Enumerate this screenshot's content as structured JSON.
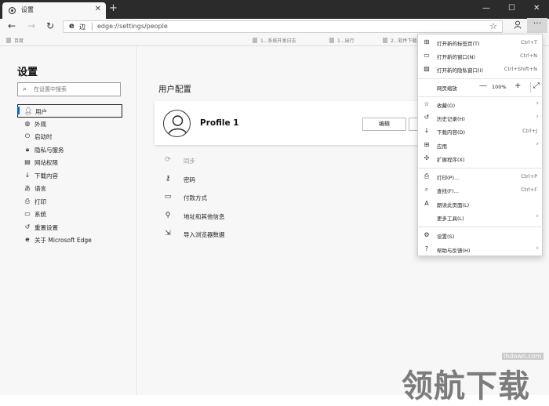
{
  "tab": {
    "title": "设置",
    "favicon": "gear-icon"
  },
  "toolbar": {
    "site_label": "边",
    "url": "edge://settings/people"
  },
  "favorites_bar": [
    {
      "label": "百度"
    },
    {
      "label": "1...系统开发日志"
    },
    {
      "label": "1...出行"
    },
    {
      "label": "2...软件下载"
    }
  ],
  "sidebar": {
    "title": "设置",
    "search_placeholder": "在设置中搜索",
    "items": [
      {
        "label": "用户",
        "icon": "person-icon",
        "active": true
      },
      {
        "label": "外观",
        "icon": "palette-icon"
      },
      {
        "label": "启动时",
        "icon": "power-icon"
      },
      {
        "label": "隐私与服务",
        "icon": "lock-icon"
      },
      {
        "label": "网站权限",
        "icon": "site-permissions-icon"
      },
      {
        "label": "下载内容",
        "icon": "download-icon"
      },
      {
        "label": "语言",
        "icon": "language-icon"
      },
      {
        "label": "打印",
        "icon": "printer-icon"
      },
      {
        "label": "系统",
        "icon": "laptop-icon"
      },
      {
        "label": "重置设置",
        "icon": "reset-icon"
      },
      {
        "label": "关于 Microsoft Edge",
        "icon": "edge-logo-icon"
      }
    ]
  },
  "main": {
    "section_title": "用户配置",
    "profile_name": "Profile 1",
    "edit_label": "编辑",
    "rows": [
      {
        "label": "同步",
        "icon": "sync-icon",
        "disabled": true
      },
      {
        "label": "密码",
        "icon": "key-icon"
      },
      {
        "label": "付款方式",
        "icon": "card-icon"
      },
      {
        "label": "地址和其他信息",
        "icon": "location-icon"
      },
      {
        "label": "导入浏览器数据",
        "icon": "import-icon"
      }
    ]
  },
  "menu": {
    "items_top": [
      {
        "label": "打开新的标签页(T)",
        "shortcut": "Ctrl+T",
        "icon": "new-tab-icon"
      },
      {
        "label": "打开新的窗口(N)",
        "shortcut": "Ctrl+N",
        "icon": "new-window-icon"
      },
      {
        "label": "打开新的隐私窗口(I)",
        "shortcut": "Ctrl+Shift+N",
        "icon": "inprivate-icon"
      }
    ],
    "zoom": {
      "label": "网页缩放",
      "value": "100%",
      "minus": "—",
      "plus": "+"
    },
    "items_mid": [
      {
        "label": "收藏(O)",
        "icon": "star-icon",
        "submenu": true
      },
      {
        "label": "历史记录(H)",
        "icon": "history-icon",
        "submenu": true
      },
      {
        "label": "下载内容(D)",
        "shortcut": "Ctrl+J",
        "icon": "download-icon"
      },
      {
        "label": "应用",
        "icon": "apps-icon",
        "submenu": true
      },
      {
        "label": "扩展程序(X)",
        "icon": "extensions-icon"
      }
    ],
    "items_tools": [
      {
        "label": "打印(P)...",
        "shortcut": "Ctrl+P",
        "icon": "printer-icon"
      },
      {
        "label": "查找(F)...",
        "shortcut": "Ctrl+F",
        "icon": "find-icon"
      },
      {
        "label": "朗读此页面(L)",
        "icon": "read-aloud-icon"
      },
      {
        "label": "更多工具(L)",
        "icon": "",
        "submenu": true
      }
    ],
    "items_bottom": [
      {
        "label": "设置(S)",
        "icon": "gear-icon"
      },
      {
        "label": "帮助与反馈(H)",
        "icon": "help-icon",
        "submenu": true
      }
    ]
  },
  "watermark": {
    "site": "lhdown.com",
    "brand": "领航下载"
  }
}
